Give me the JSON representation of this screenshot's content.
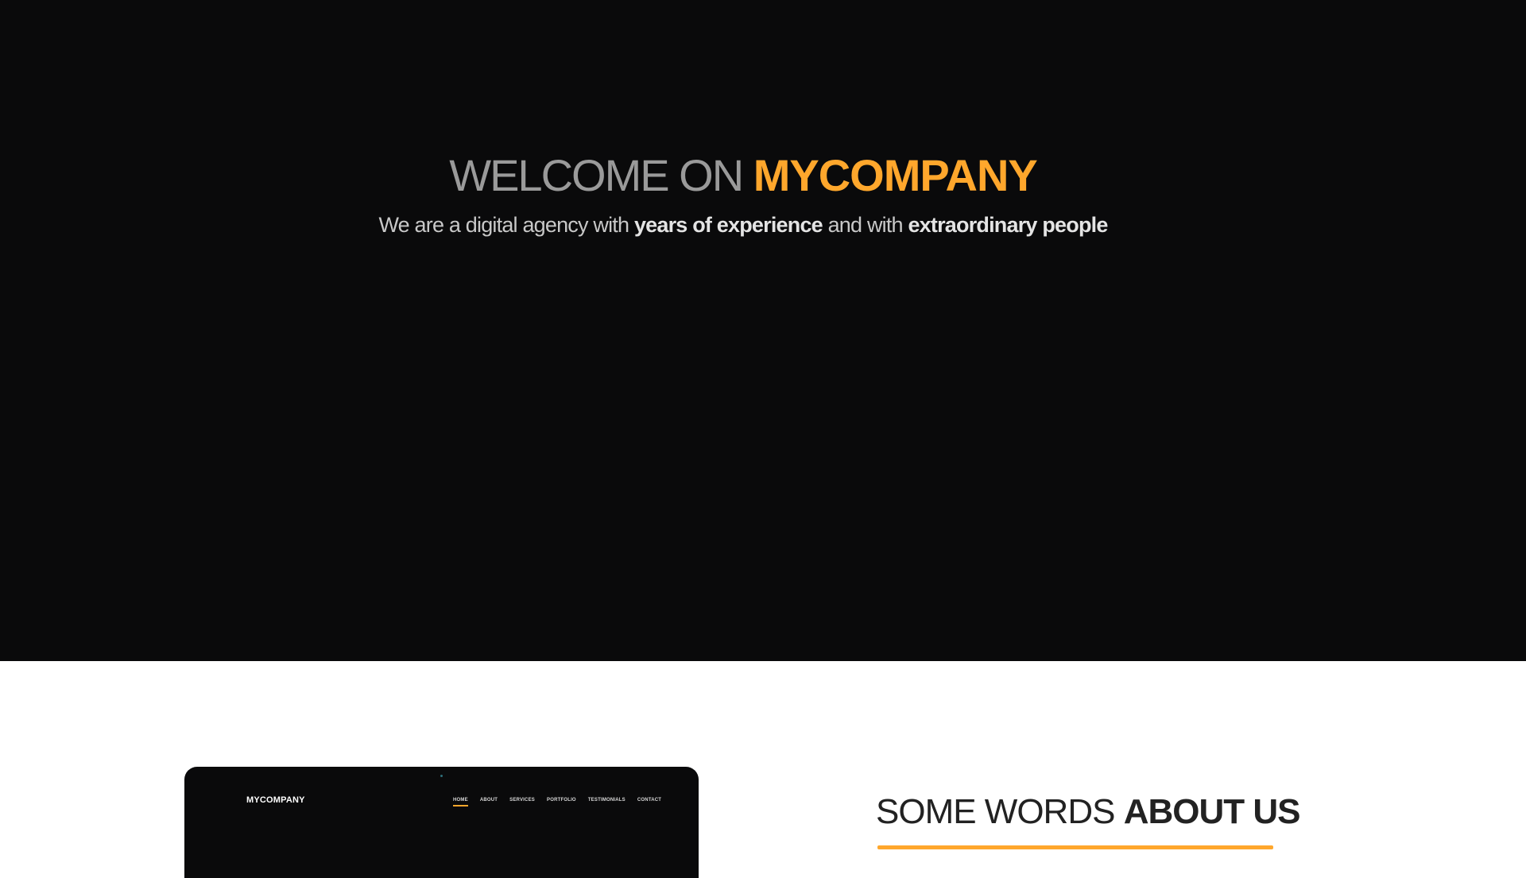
{
  "hero": {
    "title_prefix": "WELCOME ON",
    "title_brand": "MYCOMPANY",
    "subtitle_part1": "We are a digital agency with",
    "subtitle_bold1": "years of experience",
    "subtitle_part2": "and with",
    "subtitle_bold2": "extraordinary people"
  },
  "about": {
    "title_prefix": "SOME WORDS",
    "title_bold": "ABOUT US"
  },
  "mockup": {
    "brand": "MYCOMPANY",
    "nav": [
      "HOME",
      "ABOUT",
      "SERVICES",
      "PORTFOLIO",
      "TESTIMONIALS",
      "CONTACT"
    ],
    "active_nav": "HOME"
  },
  "colors": {
    "accent": "#ffa72c",
    "hero_background": "#0a0a0b",
    "section_background": "#ffffff"
  }
}
